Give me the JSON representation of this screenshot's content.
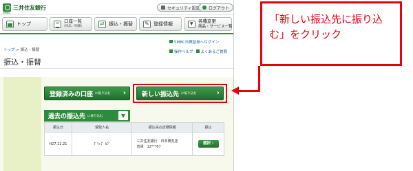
{
  "header": {
    "bank_name": "三井住友銀行",
    "bank_sub": "SMBC",
    "security_label": "セキュリティ設定",
    "logout_label": "ログアウト"
  },
  "nav": {
    "top": "トップ",
    "accounts": "口座一覧",
    "accounts_sub": "(残高／明細)",
    "transfer": "振込・振替",
    "registration": "登録情報",
    "change_line1": "各種変更",
    "change_line2": "商品・サービス一覧"
  },
  "links": {
    "smbc_notice": "SMBC日興証券へログイン",
    "help": "操作ヘルプ",
    "faq": "よくあるご質問"
  },
  "breadcrumb": {
    "home": "トップ",
    "sep": " > ",
    "current": "振込・振替"
  },
  "page_title": "振込・振替",
  "buttons": {
    "registered": "登録済みの口座",
    "registered_small": "に振り込む",
    "new_payee": "新しい振込先",
    "new_payee_small": "に振り込む",
    "past": "過去の振込先",
    "past_small": "に振り込む",
    "select": "選択"
  },
  "table": {
    "headers": [
      "振込日",
      "受取人名",
      "振込先の詳細情報",
      "振込"
    ],
    "rows": [
      {
        "date": "H27.12.21",
        "name": "ｸﾞﾘｯﾌﾟ ｶﾌﾞ",
        "detail_line1": "三井住友銀行　日本橋支店",
        "detail_line2": "普通　12***67"
      }
    ]
  },
  "callout": {
    "text": "「新しい振込先に振り込む」をクリック"
  },
  "colors": {
    "brand_green": "#2d8a3e",
    "highlight_red": "#e8000a"
  }
}
